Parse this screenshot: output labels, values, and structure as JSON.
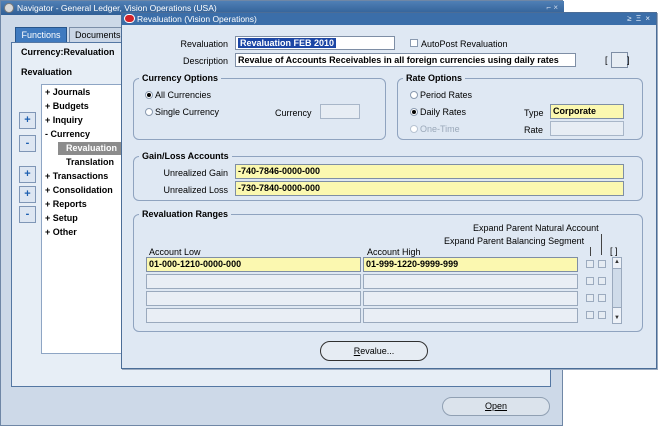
{
  "navigator": {
    "title": "Navigator - General Ledger, Vision Operations (USA)",
    "tabs": {
      "functions": "Functions",
      "documents": "Documents"
    },
    "heading_responsibility": "Currency:Revaluation",
    "heading_function": "Revaluation",
    "tree": [
      {
        "label": "+ Journals"
      },
      {
        "label": "+ Budgets"
      },
      {
        "label": "+ Inquiry"
      },
      {
        "label": "- Currency"
      },
      {
        "label": "Revaluation"
      },
      {
        "label": "Translation"
      },
      {
        "label": "+ Transactions"
      },
      {
        "label": "+ Consolidation"
      },
      {
        "label": "+ Reports"
      },
      {
        "label": "+ Setup"
      },
      {
        "label": "+ Other"
      }
    ],
    "side_buttons": [
      "+",
      "-",
      "+",
      "+",
      "-"
    ],
    "open_button": "Open"
  },
  "revaluation_window": {
    "title": "Revaluation (Vision Operations)",
    "title_controls": "≥ Ξ ×",
    "revaluation_label": "Revaluation",
    "revaluation_value": "Revaluation FEB 2010",
    "autopost_label": "AutoPost Revaluation",
    "description_label": "Description",
    "description_value": "Revalue of Accounts Receivables in all foreign currencies using daily rates",
    "dff_bracket_left": "[",
    "dff_bracket_right": "]",
    "currency_options": {
      "title": "Currency Options",
      "all_currencies": "All Currencies",
      "single_currency": "Single Currency",
      "currency_label": "Currency",
      "currency_value": ""
    },
    "rate_options": {
      "title": "Rate Options",
      "period_rates": "Period Rates",
      "daily_rates": "Daily Rates",
      "one_time": "One-Time",
      "type_label": "Type",
      "type_value": "Corporate",
      "rate_label": "Rate",
      "rate_value": ""
    },
    "gain_loss": {
      "title": "Gain/Loss Accounts",
      "gain_label": "Unrealized Gain",
      "gain_value": "-740-7846-0000-000",
      "loss_label": "Unrealized Loss",
      "loss_value": "-730-7840-0000-000"
    },
    "ranges": {
      "title": "Revaluation Ranges",
      "expand_natural": "Expand Parent Natural Account",
      "expand_balancing": "Expand Parent Balancing Segment",
      "bracket": "[ ]",
      "col_low": "Account Low",
      "col_high": "Account High",
      "rows": [
        {
          "low": "01-000-1210-0000-000",
          "high": "01-999-1220-9999-999"
        },
        {
          "low": "",
          "high": ""
        },
        {
          "low": "",
          "high": ""
        },
        {
          "low": "",
          "high": ""
        }
      ]
    },
    "revalue_button_first": "R",
    "revalue_button_rest": "evalue..."
  }
}
